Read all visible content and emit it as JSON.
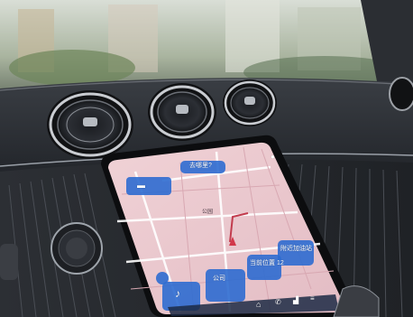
{
  "photo": {
    "subject": "car dashboard infotainment touchscreen with navigation map",
    "colors": {
      "dash": "#2a2d33",
      "trim": "#b8bcc2",
      "map": "#e9c9cf",
      "tile": "#2f6fd0",
      "sky": "#cfd6cf"
    }
  },
  "screen": {
    "destination_chip": "去哪里?",
    "route_chip": "",
    "tile_mid": "公司",
    "tile_mid_sub": "",
    "tile_right": "当前位置 12",
    "tile_far_right": "附近加油站",
    "map_place": "公园",
    "icons": [
      "car-icon",
      "music-note-icon",
      "home-icon",
      "phone-icon",
      "seat-icon",
      "menu-icon",
      "mic-icon"
    ]
  }
}
